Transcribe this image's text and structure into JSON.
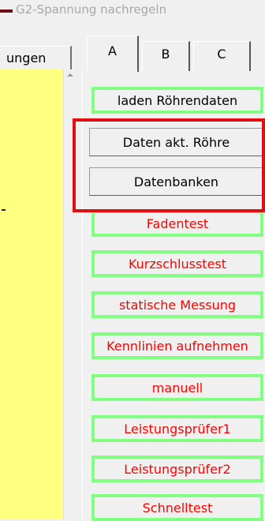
{
  "menu": {
    "partial_item": "G2-Spannung nachregeln"
  },
  "left_tab": {
    "label": "ungen"
  },
  "tabs": [
    {
      "label": "A"
    },
    {
      "label": "B"
    },
    {
      "label": "C"
    }
  ],
  "buttons": [
    {
      "label": "laden Röhrendaten",
      "color": "#000000"
    },
    {
      "label": "Daten akt. Röhre",
      "color": "#000000"
    },
    {
      "label": "Datenbanken",
      "color": "#000000"
    },
    {
      "label": "Fadentest",
      "color": "#ff0000"
    },
    {
      "label": "Kurzschlusstest",
      "color": "#ff0000"
    },
    {
      "label": "statische Messung",
      "color": "#ff0000"
    },
    {
      "label": "Kennlinien aufnehmen",
      "color": "#ff0000"
    },
    {
      "label": "manuell",
      "color": "#ff0000"
    },
    {
      "label": "Leistungsprüfer1",
      "color": "#ff0000"
    },
    {
      "label": "Leistungsprüfer2",
      "color": "#ff0000"
    },
    {
      "label": "Schnelltest",
      "color": "#ff0000"
    }
  ],
  "colors": {
    "button_border": "#80ff80",
    "highlight_box": "#e01010",
    "left_panel": "#ffff80"
  }
}
